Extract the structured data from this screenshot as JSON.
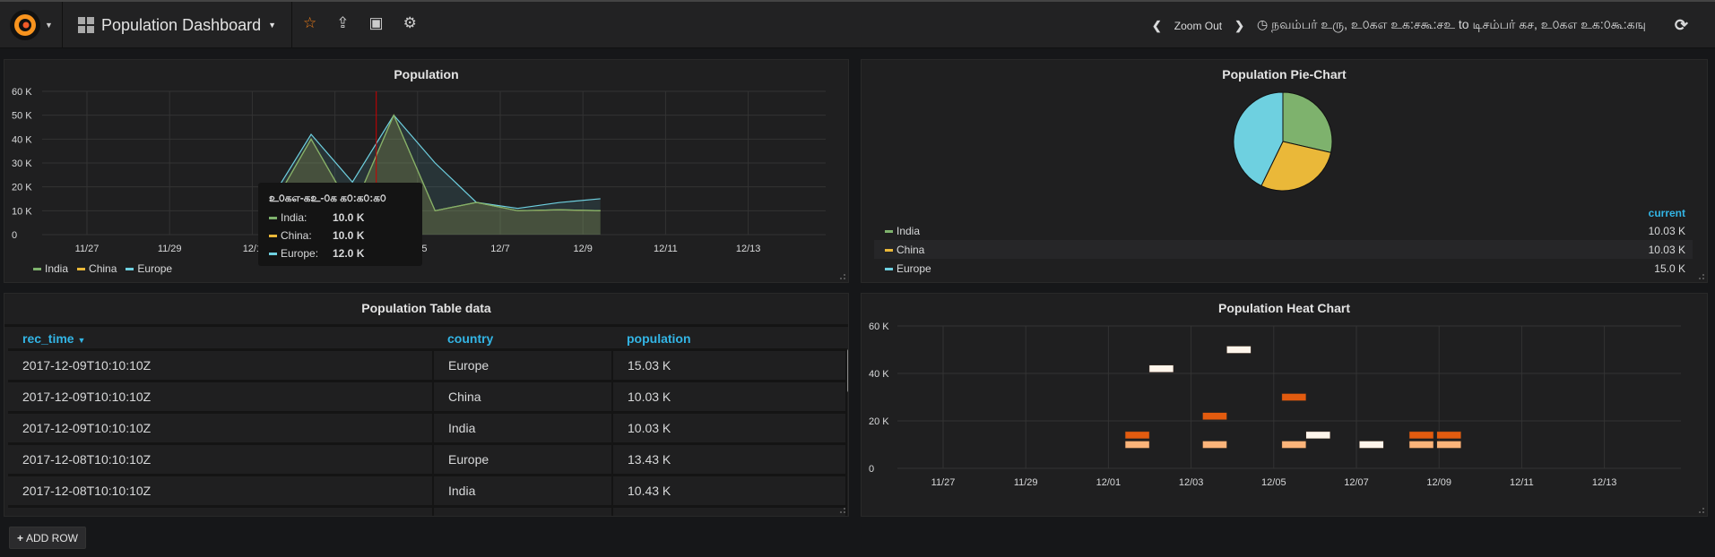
{
  "nav": {
    "dashboard_title": "Population Dashboard",
    "zoom_out": "Zoom Out",
    "time_range": "நவம்பர் உரு, உ௦கஎ உக:சகூ:சஉ to டிசம்பர் கச, உ௦கஎ உக:௦கூ:கஙு",
    "icons": [
      "grafana-logo",
      "dashboard-grid-icon",
      "star-icon",
      "share-icon",
      "save-icon",
      "gear-icon",
      "chevron-left-icon",
      "chevron-right-icon",
      "clock-icon",
      "refresh-icon"
    ],
    "star_color": "#eb7b18"
  },
  "colors": {
    "India": "#7eb26d",
    "China": "#eab839",
    "Europe": "#6ed0e0",
    "accent": "#33b5e5"
  },
  "line_panel": {
    "title": "Population",
    "tooltip": {
      "time": "உ௦கஎ-கஉ-௦க க௦:க௦:க௦",
      "rows": [
        {
          "name": "India:",
          "value": "10.0 K",
          "color": "#7eb26d"
        },
        {
          "name": "China:",
          "value": "10.0 K",
          "color": "#eab839"
        },
        {
          "name": "Europe:",
          "value": "12.0 K",
          "color": "#6ed0e0"
        }
      ]
    },
    "legend": [
      {
        "name": "India",
        "color": "#7eb26d"
      },
      {
        "name": "China",
        "color": "#eab839"
      },
      {
        "name": "Europe",
        "color": "#6ed0e0"
      }
    ]
  },
  "pie_panel": {
    "title": "Population Pie-Chart",
    "legend_header": "current",
    "rows": [
      {
        "name": "India",
        "value": "10.03 K",
        "color": "#7eb26d"
      },
      {
        "name": "China",
        "value": "10.03 K",
        "color": "#eab839"
      },
      {
        "name": "Europe",
        "value": "15.0 K",
        "color": "#6ed0e0"
      }
    ]
  },
  "table_panel": {
    "title": "Population Table data",
    "columns": [
      "rec_time",
      "country",
      "population"
    ],
    "sort_icon": "caret-down-icon",
    "rows": [
      [
        "2017-12-09T10:10:10Z",
        "Europe",
        "15.03 K"
      ],
      [
        "2017-12-09T10:10:10Z",
        "China",
        "10.03 K"
      ],
      [
        "2017-12-09T10:10:10Z",
        "India",
        "10.03 K"
      ],
      [
        "2017-12-08T10:10:10Z",
        "Europe",
        "13.43 K"
      ],
      [
        "2017-12-08T10:10:10Z",
        "India",
        "10.43 K"
      ]
    ]
  },
  "heat_panel": {
    "title": "Population Heat Chart"
  },
  "add_row": "ADD ROW",
  "chart_data": [
    {
      "type": "line",
      "title": "Population",
      "x": [
        "2017-12-01T10:10",
        "2017-12-02T10:10",
        "2017-12-03T10:10",
        "2017-12-04T10:10",
        "2017-12-05T10:10",
        "2017-12-06T10:10",
        "2017-12-07T10:10",
        "2017-12-08T10:10",
        "2017-12-09T10:10"
      ],
      "series": [
        {
          "name": "India",
          "values": [
            10,
            40,
            10,
            50,
            10,
            13.5,
            10,
            10.43,
            10.03
          ]
        },
        {
          "name": "China",
          "values": [
            10,
            40,
            10,
            50,
            10,
            13.5,
            10,
            10.4,
            10.03
          ]
        },
        {
          "name": "Europe",
          "values": [
            14,
            42,
            22,
            50,
            30,
            13.5,
            11,
            13.43,
            15.03
          ]
        }
      ],
      "xticks": [
        "11/27",
        "11/29",
        "12/1",
        "12/3",
        "12/5",
        "12/7",
        "12/9",
        "12/11",
        "12/13"
      ],
      "xlim": [
        "2017-11-26",
        "2017-12-15"
      ],
      "yticks": [
        "0",
        "10 K",
        "20 K",
        "30 K",
        "40 K",
        "50 K",
        "60 K"
      ],
      "ylim": [
        0,
        60
      ],
      "grid": true,
      "legend": "bottom-left",
      "crosshair": "2017-12-04T00:00"
    },
    {
      "type": "pie",
      "title": "Population Pie-Chart",
      "categories": [
        "India",
        "China",
        "Europe"
      ],
      "values": [
        10.03,
        10.03,
        15.0
      ],
      "legend": "bottom"
    },
    {
      "type": "heatmap",
      "title": "Population Heat Chart",
      "cells": [
        {
          "x": "2017-12-01T17:00",
          "y": 14,
          "color": "#e25b0f"
        },
        {
          "x": "2017-12-01T17:00",
          "y": 10,
          "color": "#fcb47a"
        },
        {
          "x": "2017-12-02T07:00",
          "y": 42,
          "color": "#fff5eb"
        },
        {
          "x": "2017-12-03T14:00",
          "y": 22,
          "color": "#e25b0f"
        },
        {
          "x": "2017-12-03T14:00",
          "y": 10,
          "color": "#fcb47a"
        },
        {
          "x": "2017-12-04T04:00",
          "y": 50,
          "color": "#fff5eb"
        },
        {
          "x": "2017-12-05T12:00",
          "y": 30,
          "color": "#e25b0f"
        },
        {
          "x": "2017-12-05T12:00",
          "y": 10,
          "color": "#fcb47a"
        },
        {
          "x": "2017-12-06T02:00",
          "y": 14,
          "color": "#fff5eb"
        },
        {
          "x": "2017-12-07T09:00",
          "y": 10,
          "color": "#fff5eb"
        },
        {
          "x": "2017-12-08T14:00",
          "y": 14,
          "color": "#e25b0f"
        },
        {
          "x": "2017-12-08T14:00",
          "y": 10,
          "color": "#fcb47a"
        },
        {
          "x": "2017-12-09T06:00",
          "y": 14,
          "color": "#e25b0f"
        },
        {
          "x": "2017-12-09T06:00",
          "y": 10,
          "color": "#fcb47a"
        }
      ],
      "xticks": [
        "11/27",
        "11/29",
        "12/01",
        "12/03",
        "12/05",
        "12/07",
        "12/09",
        "12/11",
        "12/13"
      ],
      "yticks": [
        "0",
        "20 K",
        "40 K",
        "60 K"
      ],
      "ylim": [
        0,
        60
      ],
      "grid": true
    }
  ]
}
